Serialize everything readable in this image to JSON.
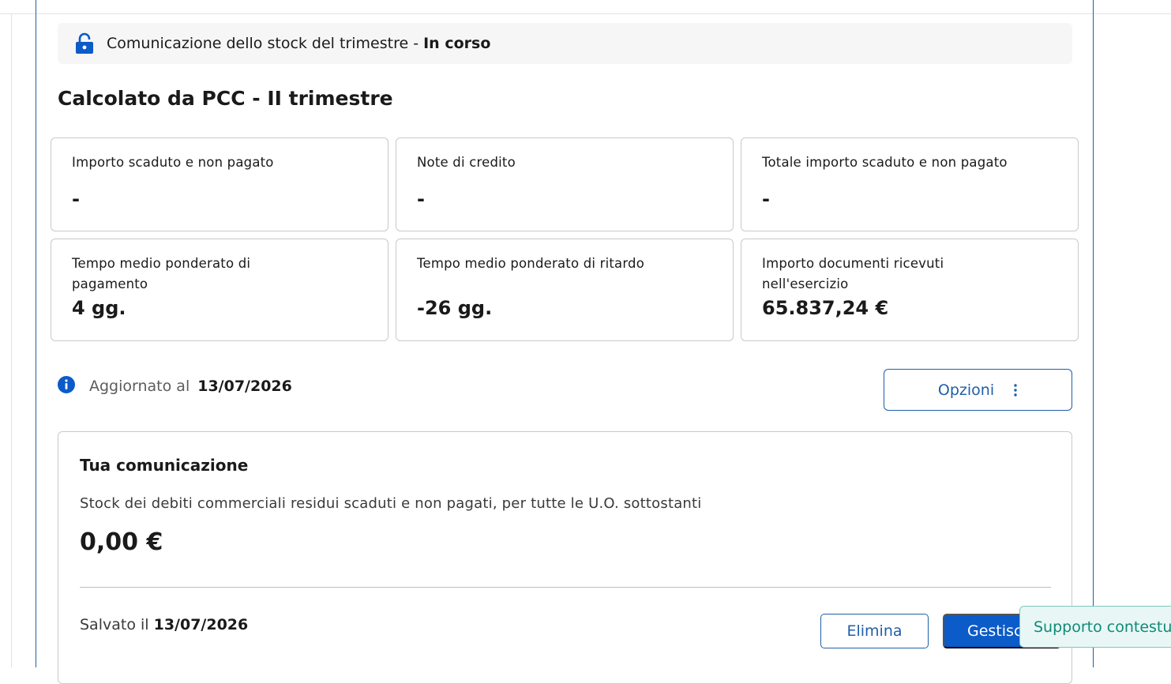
{
  "status": {
    "text": "Comunicazione dello stock del trimestre - ",
    "state": "In corso"
  },
  "section_title": "Calcolato da PCC - II trimestre",
  "cards": [
    {
      "label": "Importo scaduto e non pagato",
      "value": "-"
    },
    {
      "label": "Note di credito",
      "value": "-"
    },
    {
      "label": "Totale importo scaduto e non pagato",
      "value": "-"
    },
    {
      "label": "Tempo medio ponderato di pagamento",
      "value": "4 gg."
    },
    {
      "label": "Tempo medio ponderato di ritardo",
      "value": "-26 gg."
    },
    {
      "label": "Importo documenti ricevuti nell'esercizio",
      "value": "65.837,24 €"
    }
  ],
  "updated": {
    "label": "Aggiornato al",
    "date": "13/07/2026"
  },
  "options_button": "Opzioni",
  "communication": {
    "title": "Tua comunicazione",
    "description": "Stock dei debiti commerciali residui scaduti e non pagati, per tutte le U.O. sottostanti",
    "amount": "0,00 €",
    "saved_label": "Salvato il",
    "saved_date": "13/07/2026",
    "delete_button": "Elimina",
    "manage_button": "Gestisci"
  },
  "support_button": "Supporto contestuale",
  "colors": {
    "primary": "#0b5bc8",
    "outline": "#1f5fa8",
    "support_text": "#0f8a78"
  }
}
